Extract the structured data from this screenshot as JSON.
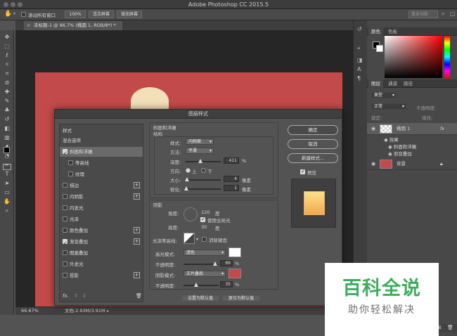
{
  "app": {
    "title": "Adobe Photoshop CC 2015.5",
    "document_tab": "未标题-1 @ 66.7% (椭圆 1, RGB/8*) *",
    "zoom": "66.67%",
    "doc_size": "文档:2.93M/3.91M",
    "tab_close": "×"
  },
  "options_bar": {
    "scroll_all": "滚动所有窗口",
    "zoom100": "100%",
    "fit_screen": "适合屏幕",
    "fill_screen": "填充屏幕",
    "search_placeholder": "基本功能"
  },
  "toolbar": {
    "tools": [
      "move-icon",
      "marquee-icon",
      "lasso-icon",
      "magic-wand-icon",
      "crop-icon",
      "eyedropper-icon",
      "healing-icon",
      "brush-icon",
      "stamp-icon",
      "history-brush-icon",
      "eraser-icon",
      "gradient-icon",
      "blur-icon",
      "dodge-icon",
      "pen-icon",
      "type-icon",
      "path-select-icon",
      "shape-icon",
      "hand-icon",
      "zoom-icon"
    ],
    "glyphs": [
      "✥",
      "⬚",
      "ℓ",
      "✧",
      "⌗",
      "⊘",
      "✚",
      "✎",
      "♣",
      "↺",
      "◧",
      "▥",
      "◖",
      "◔",
      "✒",
      "T",
      "➤",
      "▭",
      "✋",
      "⌕"
    ]
  },
  "color_panel": {
    "tabs": [
      "颜色",
      "色板"
    ],
    "fg_color": "#000000",
    "bg_color": "#ffffff"
  },
  "layers_panel": {
    "tabs": [
      "图层",
      "通道",
      "路径"
    ],
    "kind": "类型",
    "blend": "正常",
    "opacity_label": "不透明度:",
    "fill_label": "填充:",
    "lock_label": "锁定:",
    "layers": [
      {
        "name": "椭圆 1",
        "fx": "fx"
      },
      {
        "name": "效果"
      },
      {
        "name": "斜面和浮雕"
      },
      {
        "name": "渐变叠加"
      },
      {
        "name": "背景"
      }
    ]
  },
  "dialog": {
    "title": "图层样式",
    "list_header": "样式",
    "items": [
      {
        "label": "混合选项",
        "checkbox": false,
        "selected": false
      },
      {
        "label": "斜面和浮雕",
        "checkbox": true,
        "checked": true,
        "selected": true
      },
      {
        "label": "等高线",
        "checkbox": true,
        "checked": false,
        "indent": true
      },
      {
        "label": "纹理",
        "checkbox": true,
        "checked": false,
        "indent": true
      },
      {
        "label": "描边",
        "checkbox": true,
        "checked": false,
        "plus": true
      },
      {
        "label": "内阴影",
        "checkbox": true,
        "checked": false,
        "plus": true
      },
      {
        "label": "内发光",
        "checkbox": true,
        "checked": false
      },
      {
        "label": "光泽",
        "checkbox": true,
        "checked": false
      },
      {
        "label": "颜色叠加",
        "checkbox": true,
        "checked": false,
        "plus": true
      },
      {
        "label": "渐变叠加",
        "checkbox": true,
        "checked": true,
        "plus": true
      },
      {
        "label": "图案叠加",
        "checkbox": true,
        "checked": false
      },
      {
        "label": "外发光",
        "checkbox": true,
        "checked": false
      },
      {
        "label": "投影",
        "checkbox": true,
        "checked": false,
        "plus": true
      }
    ],
    "fx": "fx.",
    "bevel": {
      "section": "斜面和浮雕",
      "structure": "结构",
      "style_label": "样式:",
      "style_value": "内斜面",
      "method_label": "方法:",
      "method_value": "平滑",
      "depth_label": "深度:",
      "depth_value": "411",
      "percent": "%",
      "direction_label": "方向:",
      "up": "上",
      "down": "下",
      "size_label": "大小:",
      "size_value": "4",
      "soften_label": "软化:",
      "soften_value": "1",
      "pixel": "像素",
      "depth_level": 0.41,
      "size_level": 0.03,
      "soften_level": 0.01
    },
    "shading": {
      "section": "阴影",
      "angle_label": "角度:",
      "angle_value": "120",
      "degree": "度",
      "global_light": "使用全局光",
      "altitude_label": "高度:",
      "altitude_value": "30",
      "gloss_label": "光泽等高线:",
      "antialias": "消除锯齿",
      "highlight_mode_label": "高光模式:",
      "highlight_mode": "滤色",
      "highlight_color": "#ffffff",
      "highlight_opacity_label": "不透明度:",
      "highlight_opacity": "89",
      "shadow_mode_label": "阴影模式:",
      "shadow_mode": "正片叠底",
      "shadow_color": "#c24a4a",
      "shadow_opacity_label": "不透明度:",
      "shadow_opacity": "35",
      "percent": "%",
      "highlight_level": 0.89,
      "shadow_level": 0.35
    },
    "set_default": "设置为默认值",
    "reset_default": "复位为默认值",
    "ok": "确定",
    "cancel": "取消",
    "new_style": "新建样式...",
    "preview": "预览"
  },
  "watermark": {
    "main": "百科全说",
    "sub": "助你轻松解决"
  }
}
